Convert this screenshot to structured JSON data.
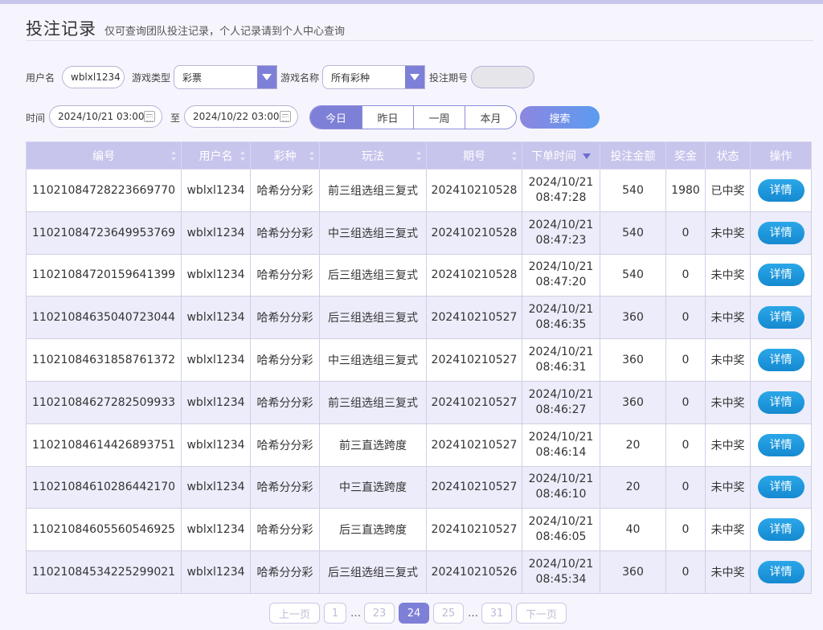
{
  "header": {
    "title": "投注记录",
    "subtitle": "仅可查询团队投注记录，个人记录请到个人中心查询"
  },
  "filters": {
    "username_label": "用户名",
    "username_value": "wblxl1234",
    "game_type_label": "游戏类型",
    "game_type_value": "彩票",
    "game_name_label": "游戏名称",
    "game_name_value": "所有彩种",
    "period_label": "投注期号",
    "period_value": "",
    "time_label": "时间",
    "start_time": "2024/10/21 03:00",
    "to_label": "至",
    "end_time": "2024/10/22 03:00",
    "ranges": [
      "今日",
      "昨日",
      "一周",
      "本月"
    ],
    "active_range": "今日",
    "search_label": "搜索"
  },
  "table": {
    "columns": [
      "编号",
      "用户名",
      "彩种",
      "玩法",
      "期号",
      "下单时间",
      "投注金额",
      "奖金",
      "状态",
      "操作"
    ],
    "detail_label": "详情",
    "rows": [
      {
        "id": "11021084728223669770",
        "user": "wblxl1234",
        "lottery": "哈希分分彩",
        "play": "前三组选组三复式",
        "period": "202410210528",
        "date": "2024/10/21",
        "time": "08:47:28",
        "amount": "540",
        "prize": "1980",
        "status": "已中奖",
        "won": true
      },
      {
        "id": "11021084723649953769",
        "user": "wblxl1234",
        "lottery": "哈希分分彩",
        "play": "中三组选组三复式",
        "period": "202410210528",
        "date": "2024/10/21",
        "time": "08:47:23",
        "amount": "540",
        "prize": "0",
        "status": "未中奖",
        "won": false
      },
      {
        "id": "11021084720159641399",
        "user": "wblxl1234",
        "lottery": "哈希分分彩",
        "play": "后三组选组三复式",
        "period": "202410210528",
        "date": "2024/10/21",
        "time": "08:47:20",
        "amount": "540",
        "prize": "0",
        "status": "未中奖",
        "won": false
      },
      {
        "id": "11021084635040723044",
        "user": "wblxl1234",
        "lottery": "哈希分分彩",
        "play": "后三组选组三复式",
        "period": "202410210527",
        "date": "2024/10/21",
        "time": "08:46:35",
        "amount": "360",
        "prize": "0",
        "status": "未中奖",
        "won": false
      },
      {
        "id": "11021084631858761372",
        "user": "wblxl1234",
        "lottery": "哈希分分彩",
        "play": "中三组选组三复式",
        "period": "202410210527",
        "date": "2024/10/21",
        "time": "08:46:31",
        "amount": "360",
        "prize": "0",
        "status": "未中奖",
        "won": false
      },
      {
        "id": "11021084627282509933",
        "user": "wblxl1234",
        "lottery": "哈希分分彩",
        "play": "前三组选组三复式",
        "period": "202410210527",
        "date": "2024/10/21",
        "time": "08:46:27",
        "amount": "360",
        "prize": "0",
        "status": "未中奖",
        "won": false
      },
      {
        "id": "11021084614426893751",
        "user": "wblxl1234",
        "lottery": "哈希分分彩",
        "play": "前三直选跨度",
        "period": "202410210527",
        "date": "2024/10/21",
        "time": "08:46:14",
        "amount": "20",
        "prize": "0",
        "status": "未中奖",
        "won": false
      },
      {
        "id": "11021084610286442170",
        "user": "wblxl1234",
        "lottery": "哈希分分彩",
        "play": "中三直选跨度",
        "period": "202410210527",
        "date": "2024/10/21",
        "time": "08:46:10",
        "amount": "20",
        "prize": "0",
        "status": "未中奖",
        "won": false
      },
      {
        "id": "11021084605560546925",
        "user": "wblxl1234",
        "lottery": "哈希分分彩",
        "play": "后三直选跨度",
        "period": "202410210527",
        "date": "2024/10/21",
        "time": "08:46:05",
        "amount": "40",
        "prize": "0",
        "status": "未中奖",
        "won": false
      },
      {
        "id": "11021084534225299021",
        "user": "wblxl1234",
        "lottery": "哈希分分彩",
        "play": "后三组选组三复式",
        "period": "202410210526",
        "date": "2024/10/21",
        "time": "08:45:34",
        "amount": "360",
        "prize": "0",
        "status": "未中奖",
        "won": false
      }
    ]
  },
  "pagination": {
    "prev_label": "上一页",
    "next_label": "下一页",
    "pages": [
      "1",
      "…",
      "23",
      "24",
      "25",
      "…",
      "31"
    ],
    "current": "24"
  },
  "colors": {
    "accent": "#7e7fd6",
    "header_bg": "#c7c5ec",
    "won_text": "#e0433a",
    "detail_button": "#1e97dc"
  }
}
